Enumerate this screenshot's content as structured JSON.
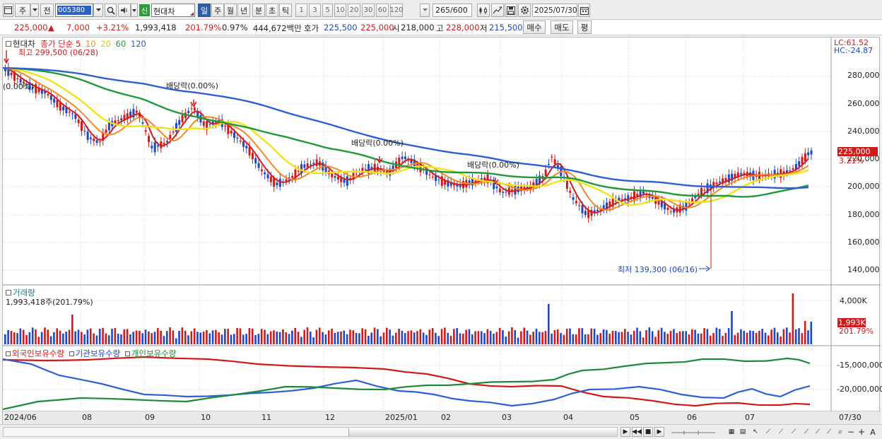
{
  "toolbar": {
    "icons": [
      "window-icon",
      "dropdown-icon",
      "search-icon",
      "speaker-icon",
      "settings-icon"
    ],
    "week_label": "주",
    "prev_label": "전",
    "stock_code": "005380",
    "new_badge": "신",
    "stock_name": "현대차",
    "periods": [
      "일",
      "주",
      "월",
      "년",
      "분",
      "초",
      "틱"
    ],
    "active_period": "일",
    "intervals": [
      "1",
      "3",
      "5",
      "10",
      "20",
      "30",
      "60",
      "120"
    ],
    "bar_count": "265",
    "bar_total": "/600",
    "date": "2025/07/30"
  },
  "quote": {
    "price": "225,000",
    "change_arrow": "▲",
    "change": "7,000",
    "change_pct": "+3.21%",
    "volume": "1,993,418",
    "volume_ratio": "201.79%",
    "turnover_rate": "0.97%",
    "amount": "444,672백만",
    "bid_label": "호가",
    "ask_price": "225,500",
    "bid_price": "225,000",
    "open_label": "시",
    "open": "218,000",
    "high_label": "고",
    "high": "228,000",
    "low_label": "저",
    "low": "215,500",
    "buy_button": "매수",
    "sell_button": "매도",
    "eval_button": "평"
  },
  "price_panel": {
    "stock_label": "현대차",
    "ma_label": "종가 단순",
    "ma_periods": [
      "5",
      "10",
      "20",
      "60",
      "120"
    ],
    "ma_colors": [
      "#d41b1b",
      "#f58a1f",
      "#f2e21a",
      "#1d9b3a",
      "#2f5fd6"
    ],
    "high_marker": "최고 299,500 (06/28)",
    "low_marker": "최저 139,300 (06/16)",
    "start_marker": "(0.00%)",
    "dividends": [
      "배당락(0.00%)",
      "배당락(0.00%)",
      "배당락(0.00%)"
    ],
    "lc_label": "LC:61.52",
    "hc_label": "HC:-24.87",
    "y_ticks": [
      "280,000",
      "260,000",
      "240,000",
      "220,000",
      "200,000",
      "180,000",
      "160,000",
      "140,000"
    ],
    "current_price_label": "225,000",
    "current_pct_label": "3.21%"
  },
  "volume_panel": {
    "title": "거래량",
    "value_label": "1,993,418주(201.79%)",
    "y_tick": "4,000K",
    "current_label": "1,993K",
    "current_pct": "201.79%"
  },
  "holder_panel": {
    "series": [
      "외국인보유수량",
      "기관보유수량",
      "개인보유수량"
    ],
    "series_colors": [
      "#d21919",
      "#2f5fd6",
      "#1d8a3a"
    ],
    "y_ticks": [
      "-15,000,000",
      "-20,000,000"
    ]
  },
  "x_axis": {
    "labels": [
      "2024/06",
      "08",
      "09",
      "10",
      "11",
      "12",
      "2025/01",
      "02",
      "03",
      "04",
      "05",
      "06",
      "07"
    ],
    "right_label": "07/30"
  },
  "colors": {
    "up": "#d21919",
    "down": "#1f48c8",
    "accent": "#2f5fb3"
  }
}
